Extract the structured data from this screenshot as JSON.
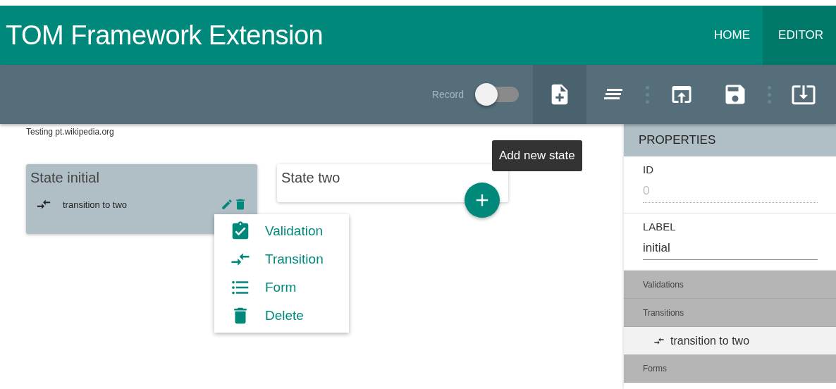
{
  "header": {
    "title": "TOM Framework Extension",
    "nav": [
      {
        "label": "HOME",
        "selected": false
      },
      {
        "label": "EDITOR",
        "selected": true
      }
    ]
  },
  "toolbar": {
    "record": {
      "label": "Record",
      "on": false
    },
    "buttons": [
      {
        "kind": "add-state",
        "selected": true
      },
      {
        "kind": "align",
        "selected": false
      },
      {
        "kind": "separator"
      },
      {
        "kind": "upload",
        "selected": false
      },
      {
        "kind": "save",
        "selected": false
      },
      {
        "kind": "separator"
      },
      {
        "kind": "download",
        "selected": false
      }
    ]
  },
  "canvas": {
    "caption": "Testing pt.wikipedia.org",
    "tooltip": "Add new state",
    "states": [
      {
        "title": "State initial",
        "selected": true,
        "transitions": [
          "transition to two"
        ]
      },
      {
        "title": "State two",
        "selected": false
      }
    ],
    "menu": [
      {
        "kind": "validation",
        "label": "Validation"
      },
      {
        "kind": "transition",
        "label": "Transition"
      },
      {
        "kind": "form",
        "label": "Form"
      },
      {
        "kind": "delete",
        "label": "Delete"
      }
    ]
  },
  "properties": {
    "title": "PROPERTIES",
    "fields": [
      {
        "label": "ID",
        "value": "0",
        "disabled": true
      },
      {
        "label": "LABEL",
        "value": "initial",
        "disabled": false
      }
    ],
    "sections": [
      {
        "title": "Validations"
      },
      {
        "title": "Transitions",
        "items": [
          "transition to two"
        ]
      },
      {
        "title": "Forms"
      }
    ]
  }
}
